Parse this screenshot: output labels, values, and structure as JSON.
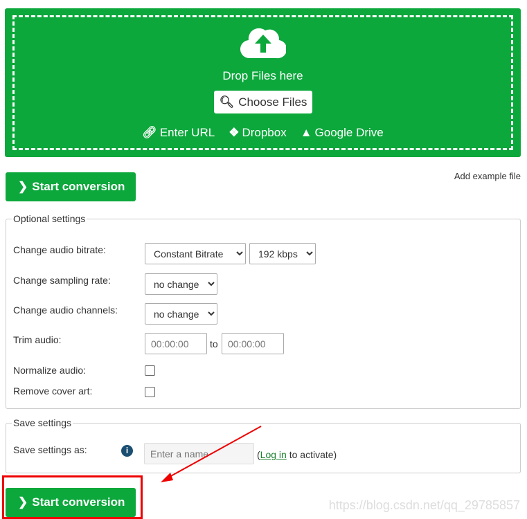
{
  "upload": {
    "drop_text": "Drop Files here",
    "choose_label": "Choose Files",
    "links": [
      {
        "label": "Enter URL",
        "icon": "link-icon"
      },
      {
        "label": "Dropbox",
        "icon": "dropbox-icon"
      },
      {
        "label": "Google Drive",
        "icon": "google-drive-icon"
      }
    ]
  },
  "start_label": "Start conversion",
  "add_example": "Add example file",
  "optional": {
    "legend": "Optional settings",
    "bitrate_label": "Change audio bitrate:",
    "bitrate_mode": "Constant Bitrate",
    "bitrate_value": "192 kbps",
    "sampling_label": "Change sampling rate:",
    "sampling_value": "no change",
    "channels_label": "Change audio channels:",
    "channels_value": "no change",
    "trim_label": "Trim audio:",
    "trim_from": "00:00:00",
    "trim_to_label": "to",
    "trim_to": "00:00:00",
    "normalize_label": "Normalize audio:",
    "cover_label": "Remove cover art:"
  },
  "save": {
    "legend": "Save settings",
    "label": "Save settings as:",
    "placeholder": "Enter a name",
    "login_pre": "(",
    "login_link": "Log in",
    "login_post": " to activate)"
  },
  "watermark": "https://blog.csdn.net/qq_29785857",
  "colors": {
    "accent": "#0ca83c",
    "highlight": "#e00000"
  }
}
